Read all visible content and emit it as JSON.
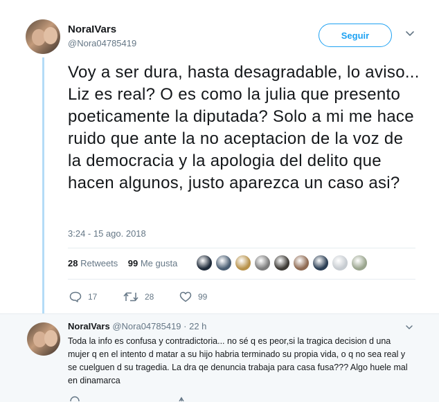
{
  "tweet": {
    "display_name": "NoraIVars",
    "handle": "@Nora04785419",
    "follow_label": "Seguir",
    "text": "Voy a ser dura, hasta desagradable, lo aviso... Liz es real? O es como la julia que presento poeticamente la diputada? Solo a mi me hace ruido que ante la no aceptacion de la voz de la democracia y la apologia del delito que hacen algunos, justo aparezca un caso asi?",
    "timestamp": "3:24 - 15 ago. 2018",
    "retweets_count": "28",
    "retweets_label": "Retweets",
    "likes_count": "99",
    "likes_label": "Me gusta",
    "liker_avatars": [
      "#1f2b3a",
      "#4a5e73",
      "#b8924a",
      "#7c7c7c",
      "#3d3a35",
      "#8f6a52",
      "#2c3f55",
      "#c7ccd1",
      "#9aa58e"
    ],
    "actions": {
      "reply_count": "17",
      "retweet_count": "28",
      "like_count": "99"
    }
  },
  "reply": {
    "display_name": "NoraIVars",
    "handle": "@Nora04785419",
    "time": "· 22 h",
    "text": "Toda la info es confusa y contradictoria... no sé q es peor,si la tragica decision d una mujer q en el intento d matar a su hijo habria terminado su propia vida, o q no sea real y se cuelguen d su tragedia. La dra qe denuncia trabaja para casa fusa??? Algo huele mal en dinamarca"
  },
  "colors": {
    "accent": "#1da1f2",
    "muted": "#657786",
    "thread_line": "#b4dcf7"
  }
}
